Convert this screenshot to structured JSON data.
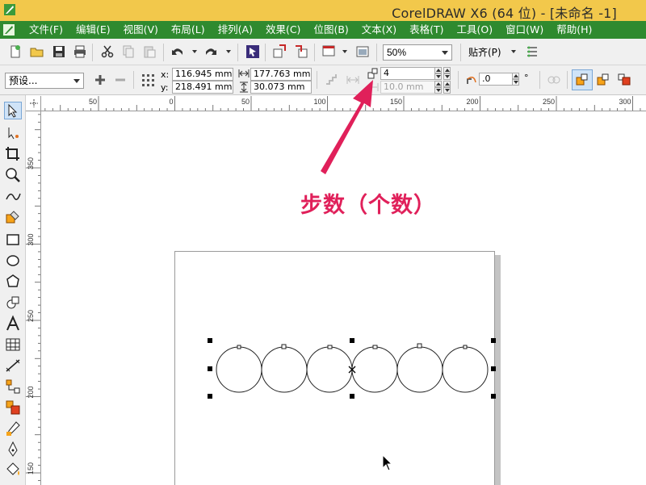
{
  "window": {
    "title": "CorelDRAW X6 (64 位) - [未命名 -1]"
  },
  "menu": {
    "items": [
      "文件(F)",
      "编辑(E)",
      "视图(V)",
      "布局(L)",
      "排列(A)",
      "效果(C)",
      "位图(B)",
      "文本(X)",
      "表格(T)",
      "工具(O)",
      "窗口(W)",
      "帮助(H)"
    ]
  },
  "toolbar": {
    "zoom": "50%",
    "snap_label": "贴齐(P)"
  },
  "property_bar": {
    "preset": "预设...",
    "x_label": "x:",
    "y_label": "y:",
    "x_value": "116.945 mm",
    "y_value": "218.491 mm",
    "width_value": "177.763 mm",
    "height_value": "30.073 mm",
    "steps_value": "4",
    "spacing_value": "10.0 mm",
    "rotation_value": ".0",
    "degree_symbol": "°"
  },
  "ruler": {
    "horizontal_labels": [
      "50",
      "0",
      "50",
      "100",
      "150",
      "200",
      "250",
      "300"
    ],
    "vertical_labels": [
      "350",
      "300",
      "250",
      "200",
      "150"
    ]
  },
  "annotation": {
    "text": "步数（个数）",
    "color": "#e0205a"
  },
  "colors": {
    "titlebar": "#f2c84b",
    "menubar": "#2f8a2f",
    "annotation": "#e0205a"
  }
}
